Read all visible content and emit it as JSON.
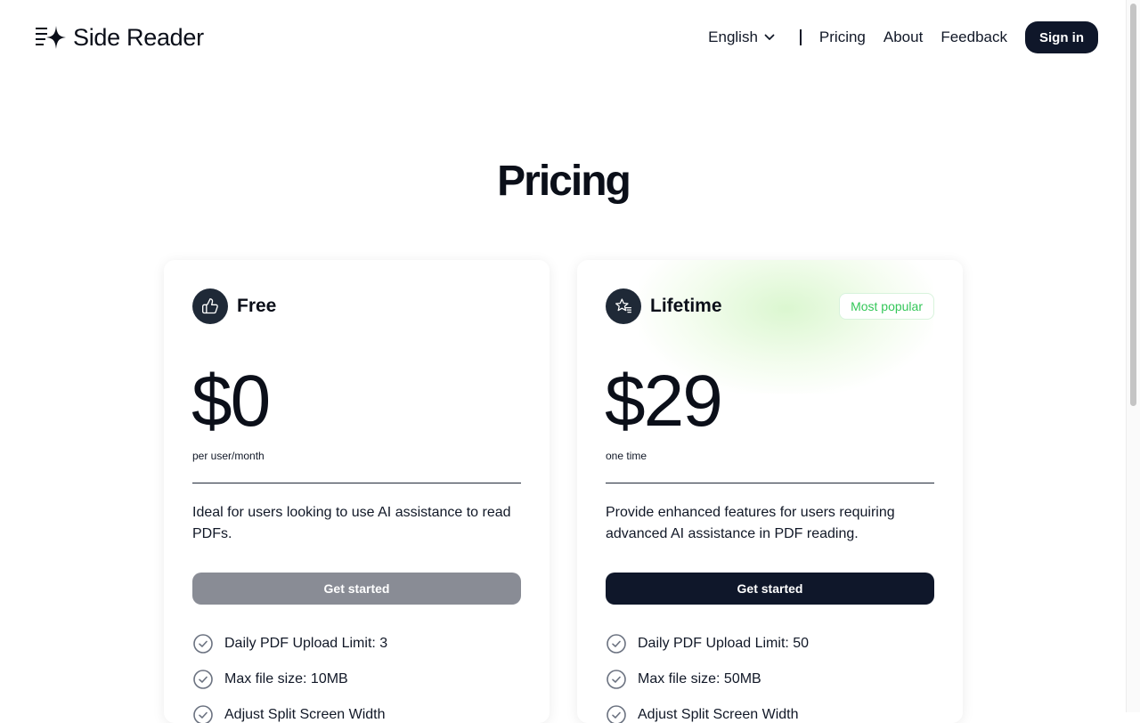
{
  "header": {
    "app_name": "Side Reader",
    "language": "English",
    "nav": [
      "Pricing",
      "About",
      "Feedback"
    ],
    "signin_label": "Sign in"
  },
  "page": {
    "title": "Pricing"
  },
  "plans": [
    {
      "name": "Free",
      "icon": "thumbs-up-icon",
      "price": "$0",
      "period": "per user/month",
      "description": "Ideal for users looking to use AI assistance to read PDFs.",
      "cta": "Get started",
      "features": [
        "Daily PDF Upload Limit: 3",
        "Max file size: 10MB",
        "Adjust Split Screen Width"
      ]
    },
    {
      "name": "Lifetime",
      "icon": "star-list-icon",
      "badge": "Most popular",
      "price": "$29",
      "period": "one time",
      "description": "Provide enhanced features for users requiring advanced AI assistance in PDF reading.",
      "cta": "Get started",
      "features": [
        "Daily PDF Upload Limit: 50",
        "Max file size: 50MB",
        "Adjust Split Screen Width"
      ]
    }
  ],
  "colors": {
    "primary_dark": "#0f172a",
    "disabled_button": "#898c95",
    "badge_green": "#34c759"
  }
}
